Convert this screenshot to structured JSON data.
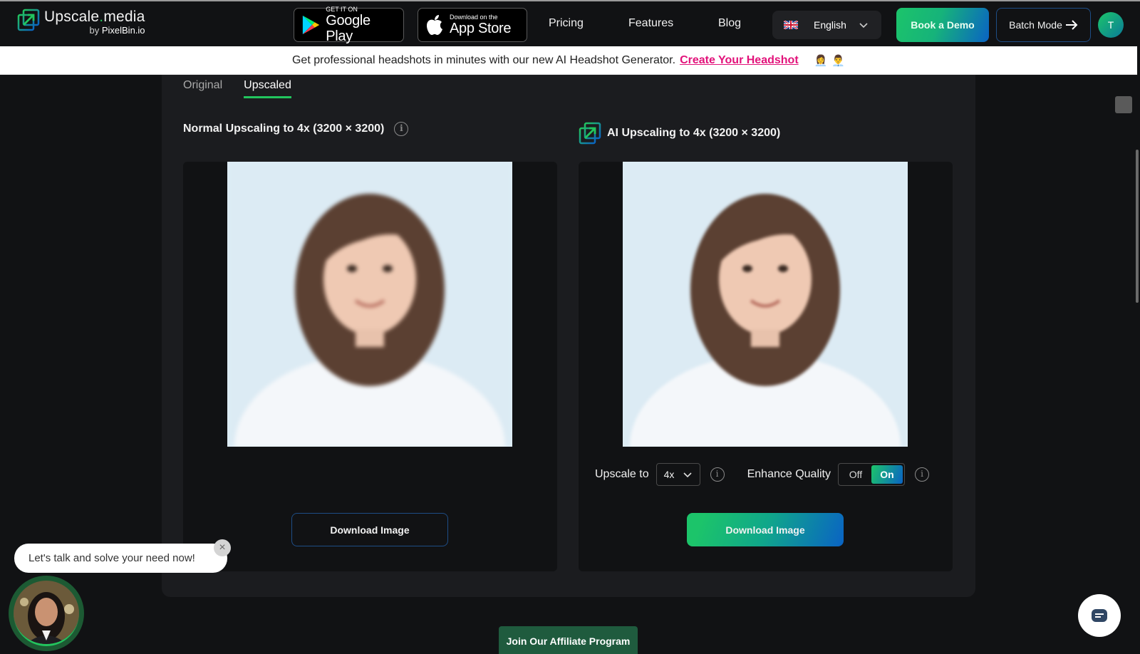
{
  "header": {
    "brand_name_a": "Upscale",
    "brand_name_dot": ".",
    "brand_name_b": "media",
    "brand_sub_prefix": "by ",
    "brand_sub_name": "PixelBin.io",
    "google_play": {
      "small": "GET IT ON",
      "big": "Google Play"
    },
    "app_store": {
      "small": "Download on the",
      "big": "App Store"
    },
    "nav": [
      "Pricing",
      "Features",
      "Blog"
    ],
    "language": "English",
    "book_demo": "Book a Demo",
    "batch_mode": "Batch Mode",
    "user_initial": "T"
  },
  "banner": {
    "text": "Get professional headshots in minutes with our new AI Headshot Generator.",
    "cta": "Create Your Headshot"
  },
  "main": {
    "tabs": [
      {
        "label": "Original",
        "active": false
      },
      {
        "label": "Upscaled",
        "active": true
      }
    ],
    "left": {
      "title": "Normal Upscaling to 4x (3200 × 3200)",
      "download": "Download Image"
    },
    "right": {
      "title": "AI Upscaling to 4x (3200 × 3200)",
      "upscale_label": "Upscale to",
      "upscale_value": "4x",
      "enhance_label": "Enhance Quality",
      "toggle_off": "Off",
      "toggle_on": "On",
      "enhance_state": "On",
      "download": "Download Image"
    }
  },
  "chat": {
    "bubble": "Let's talk and solve your need now!"
  },
  "footer": {
    "affiliate": "Join Our Affiliate Program"
  },
  "colors": {
    "accent_green": "#22c55e",
    "accent_blue": "#0a63c4",
    "link_pink": "#e2127a",
    "background": "#111214",
    "card": "#1b1c1f"
  }
}
